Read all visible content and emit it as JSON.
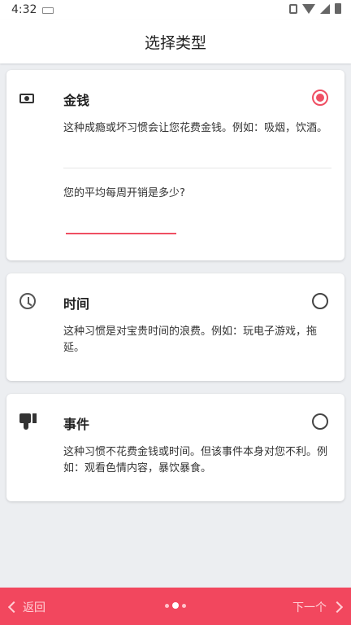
{
  "status_bar": {
    "time": "4:32"
  },
  "appbar": {
    "title": "选择类型"
  },
  "cards": [
    {
      "title": "金钱",
      "icon": "money-icon",
      "selected": true,
      "desc": "这种成瘾或坏习惯会让您花费金钱。例如：吸烟，饮酒。"
    },
    {
      "title": "时间",
      "icon": "clock-icon",
      "selected": false,
      "desc": "这种习惯是对宝贵时间的浪费。例如：玩电子游戏，拖延。"
    },
    {
      "title": "事件",
      "icon": "thumbs-down-icon",
      "selected": false,
      "desc": "这种习惯不花费金钱或时间。但该事件本身对您不利。例如：观看色情内容，暴饮暴食。"
    }
  ],
  "money_question": {
    "label": "您的平均每周开销是多少?",
    "value": ""
  },
  "footer": {
    "back_label": "返回",
    "next_label": "下一个",
    "pages": 3,
    "current_page": 2
  },
  "colors": {
    "accent": "#ef4f63",
    "footer_bg": "#f2475e",
    "page_bg": "#eceef1"
  }
}
